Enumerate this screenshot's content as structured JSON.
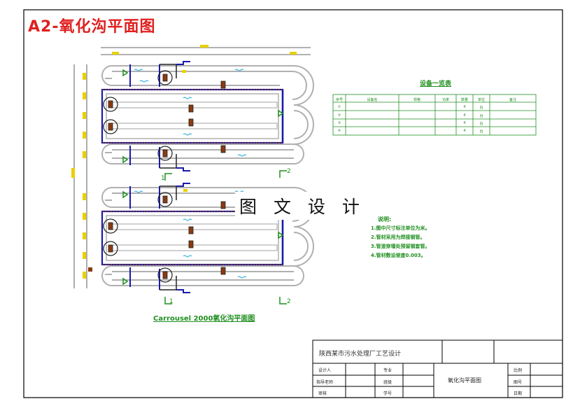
{
  "heading": "A2-氧化沟平面图",
  "watermark": "图 文 设 计",
  "drawing_caption": "Carrousel 2000氧化沟平面图",
  "section_marks": [
    "1",
    "1",
    "2",
    "2"
  ],
  "equipment": {
    "title": "设备一览表",
    "header": [
      "序号",
      "设备名",
      "规格",
      "功率",
      "数量",
      "单位",
      "备注"
    ],
    "rows": [
      [
        "①",
        "",
        "",
        "",
        "4",
        "台",
        ""
      ],
      [
        "②",
        "",
        "",
        "",
        "4",
        "台",
        ""
      ],
      [
        "③",
        "",
        "",
        "",
        "4",
        "台",
        ""
      ],
      [
        "④",
        "",
        "",
        "",
        "4",
        "台",
        ""
      ]
    ]
  },
  "notes": {
    "title": "说明:",
    "items": [
      "1.图中尺寸标注单位为米。",
      "2.管材采用为焊接钢管。",
      "3.管道穿墙处预留钢套管。",
      "4.管材敷设坡度0.003。"
    ]
  },
  "title_block": {
    "project": "陕西某市污水处理厂工艺设计",
    "drawing_name": "氧化沟平面图",
    "labels": {
      "designer": "设计人",
      "checker": "指导老师",
      "reviewer": "审核",
      "major": "专业",
      "class": "班级",
      "student_no": "学号",
      "scale": "比例",
      "sheet": "图号",
      "date": "日期"
    }
  },
  "colors": {
    "frame": "#000000",
    "heading": "#e02020",
    "blue_pipe": "#1a1aa8",
    "green": "#1f8f1f",
    "yellow_dim": "#e8d000",
    "channel": "#b0b0b0",
    "water": "#1aa8d8",
    "equipment_brown": "#8b3a10"
  }
}
